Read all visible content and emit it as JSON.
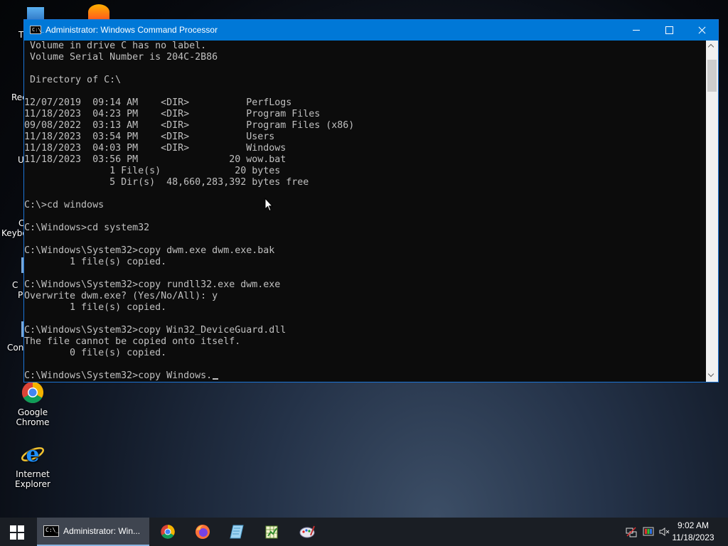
{
  "window": {
    "title": "Administrator: Windows Command Processor",
    "app_icon_text": "C:\\_"
  },
  "console": {
    "lines": [
      " Volume in drive C has no label.",
      " Volume Serial Number is 204C-2B86",
      "",
      " Directory of C:\\",
      "",
      "12/07/2019  09:14 AM    <DIR>          PerfLogs",
      "11/18/2023  04:23 PM    <DIR>          Program Files",
      "09/08/2022  03:13 AM    <DIR>          Program Files (x86)",
      "11/18/2023  03:54 PM    <DIR>          Users",
      "11/18/2023  04:03 PM    <DIR>          Windows",
      "11/18/2023  03:56 PM                20 wow.bat",
      "               1 File(s)             20 bytes",
      "               5 Dir(s)  48,660,283,392 bytes free",
      "",
      "C:\\>cd windows",
      "",
      "C:\\Windows>cd system32",
      "",
      "C:\\Windows\\System32>copy dwm.exe dwm.exe.bak",
      "        1 file(s) copied.",
      "",
      "C:\\Windows\\System32>copy rundll32.exe dwm.exe",
      "Overwrite dwm.exe? (Yes/No/All): y",
      "        1 file(s) copied.",
      "",
      "C:\\Windows\\System32>copy Win32_DeviceGuard.dll",
      "The file cannot be copied onto itself.",
      "        0 file(s) copied.",
      ""
    ],
    "current_input": "C:\\Windows\\System32>copy Windows."
  },
  "desktop": {
    "icons": [
      {
        "label": "Google Chrome",
        "icon": "chrome-icon"
      },
      {
        "label": "Internet Explorer",
        "icon": "internet-explorer-icon"
      }
    ],
    "partial_labels": [
      "T",
      "Rec",
      "U",
      "C",
      "Keybo",
      "C",
      "Co",
      "P",
      "Con"
    ]
  },
  "taskbar": {
    "active_task_label": "Administrator: Win...",
    "apps": [
      "chrome-icon",
      "firefox-icon",
      "notepad-icon",
      "spreadsheet-icon",
      "paint-icon"
    ],
    "clock": {
      "time": "9:02 AM",
      "date": "11/18/2023"
    }
  },
  "colors": {
    "titlebar": "#0078d7",
    "console_bg": "#0c0c0c",
    "console_text": "#c0c0c0",
    "taskbar": "#1a1e24"
  }
}
